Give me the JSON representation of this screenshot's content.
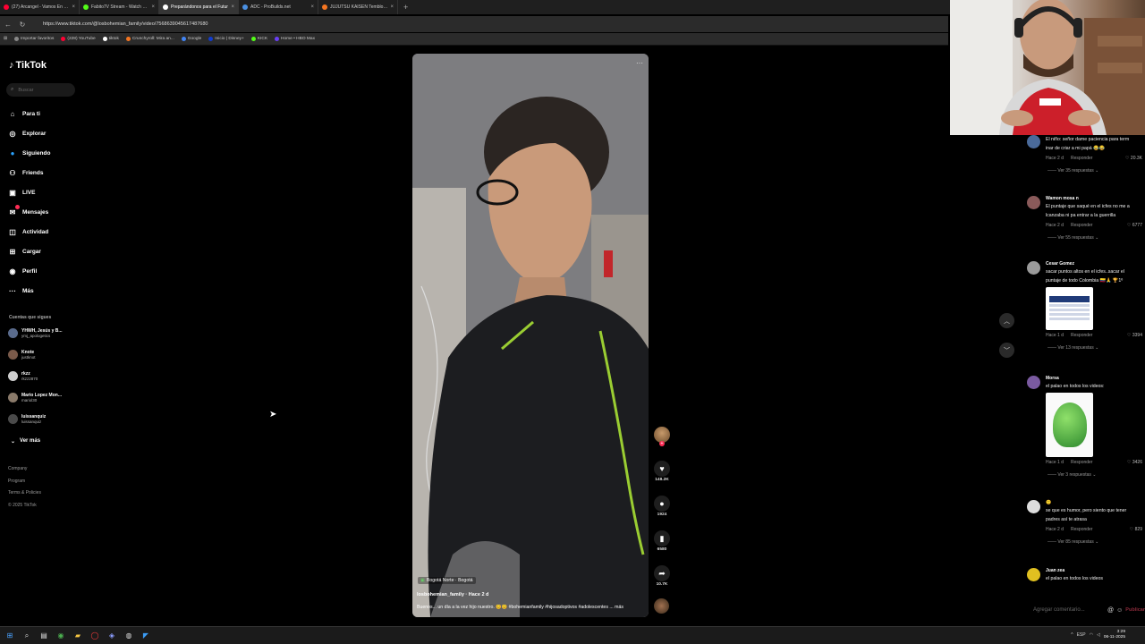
{
  "browser": {
    "tabs": [
      {
        "title": "(27) Arcangel - Vamos En Un Viaje",
        "color": "#ff0033"
      },
      {
        "title": "Fabito7V Stream - Watch Live on",
        "color": "#53fc18"
      },
      {
        "title": "Preparándonos para el Futur",
        "color": "#ffffff",
        "active": true
      },
      {
        "title": "ADC - ProBuilds.net",
        "color": "#4a90e2"
      },
      {
        "title": "JUJUTSU KAISEN Temblores, parte",
        "color": "#f47521"
      }
    ],
    "new_tab": "+",
    "url": "https://www.tiktok.com/@losbohemian_family/video/7568639045617487680",
    "bookmarks": [
      {
        "label": "Importar favoritos",
        "color": "#888888"
      },
      {
        "label": "(228) YouTube",
        "color": "#ff0033"
      },
      {
        "label": "tiktok",
        "color": "#ffffff"
      },
      {
        "label": "Crunchyroll: Mira an...",
        "color": "#f47521"
      },
      {
        "label": "Google",
        "color": "#4285f4"
      },
      {
        "label": "Inicio | Disney+",
        "color": "#113ccf"
      },
      {
        "label": "KICK",
        "color": "#53fc18"
      },
      {
        "label": "Home • HBO Max",
        "color": "#6a3ff5"
      }
    ]
  },
  "sidebar": {
    "logo": "TikTok",
    "search_placeholder": "Buscar",
    "menu": [
      {
        "label": "Para ti",
        "icon": "home-icon",
        "glyph": "⌂"
      },
      {
        "label": "Explorar",
        "icon": "compass-icon",
        "glyph": "◎"
      },
      {
        "label": "Siguiendo",
        "icon": "following-icon",
        "glyph": "●"
      },
      {
        "label": "Friends",
        "icon": "friends-icon",
        "glyph": "⚇"
      },
      {
        "label": "LIVE",
        "icon": "live-icon",
        "glyph": "▣"
      },
      {
        "label": "Mensajes",
        "icon": "messages-icon",
        "glyph": "✉"
      },
      {
        "label": "Actividad",
        "icon": "activity-icon",
        "glyph": "◫"
      },
      {
        "label": "Cargar",
        "icon": "upload-icon",
        "glyph": "⊞"
      },
      {
        "label": "Perfil",
        "icon": "profile-icon",
        "glyph": "◉"
      },
      {
        "label": "Más",
        "icon": "more-icon",
        "glyph": "···"
      }
    ],
    "following_heading": "Cuentas que sigues",
    "accounts": [
      {
        "name": "YHWH, Jesús y B...",
        "handle": "ymj_apologetics"
      },
      {
        "name": "Knote",
        "handle": "justknot"
      },
      {
        "name": "rkzz",
        "handle": "rkzz2870"
      },
      {
        "name": "Mario Lopez Mon...",
        "handle": "mariol30"
      },
      {
        "name": "luissanquiz",
        "handle": "luissanquiz"
      }
    ],
    "see_more": "Ver más",
    "footer": [
      "Company",
      "Program",
      "Terms & Policies",
      "© 2025 TikTok"
    ]
  },
  "video": {
    "location": "Bogotá Norte · Bogotá",
    "author": "losbohemian_family · Hace 2 d",
    "caption": "Buenos... un día a la vez hijo nuestro. 😊😊 #bohemianfamily #hijosadoptivos #adolescentes ... más",
    "likes": "148.2K",
    "comments": "1924",
    "saves": "6580",
    "shares": "10.7K"
  },
  "comments": [
    {
      "name": "",
      "text": [
        "El niño: señor dame paciencia para term",
        "inar de criar a mi papá 😂😂"
      ],
      "time": "Hace 2 d",
      "reply": "Responder",
      "likes": "20.3K",
      "more": "Ver 35 respuestas"
    },
    {
      "name": "Wamon mosa n",
      "text": [
        "El puntaje que saqué en el icfes no me a",
        "lcanzaba ni pa entrar a la guerrilla"
      ],
      "time": "Hace 2 d",
      "reply": "Responder",
      "likes": "6777",
      "more": "Ver 55 respuestas"
    },
    {
      "name": "Cesar Gomez",
      "text": [
        "sacar puntos altos en el icfes..sacar el",
        "puntaje de todo Colombia 🇨🇴🙏 🏆1º"
      ],
      "time": "Hace 1 d",
      "reply": "Responder",
      "likes": "3394",
      "more": "Ver 13 respuestas"
    },
    {
      "name": "Morsa",
      "text": [
        "el palao en todos los videos:"
      ],
      "time": "Hace 1 d",
      "reply": "Responder",
      "likes": "3426",
      "more": "Ver 3 respuestas"
    },
    {
      "name": "🙂",
      "text": [
        "se que es humor, pero siento que tener",
        "padres así te atrasa"
      ],
      "time": "Hace 2 d",
      "reply": "Responder",
      "likes": "829",
      "more": "Ver 85 respuestas"
    },
    {
      "name": "Juan zea",
      "text": [
        "el palao en todos los videos"
      ],
      "time": "",
      "reply": "",
      "likes": "",
      "more": ""
    }
  ],
  "comment_input": {
    "placeholder": "Agregar comentario...",
    "submit": "Publicar"
  },
  "taskbar": {
    "time": "3:29",
    "date": "06-11-2025",
    "lang": "ESP"
  },
  "colors": {
    "accent": "#fe2c55",
    "background": "#000000"
  }
}
